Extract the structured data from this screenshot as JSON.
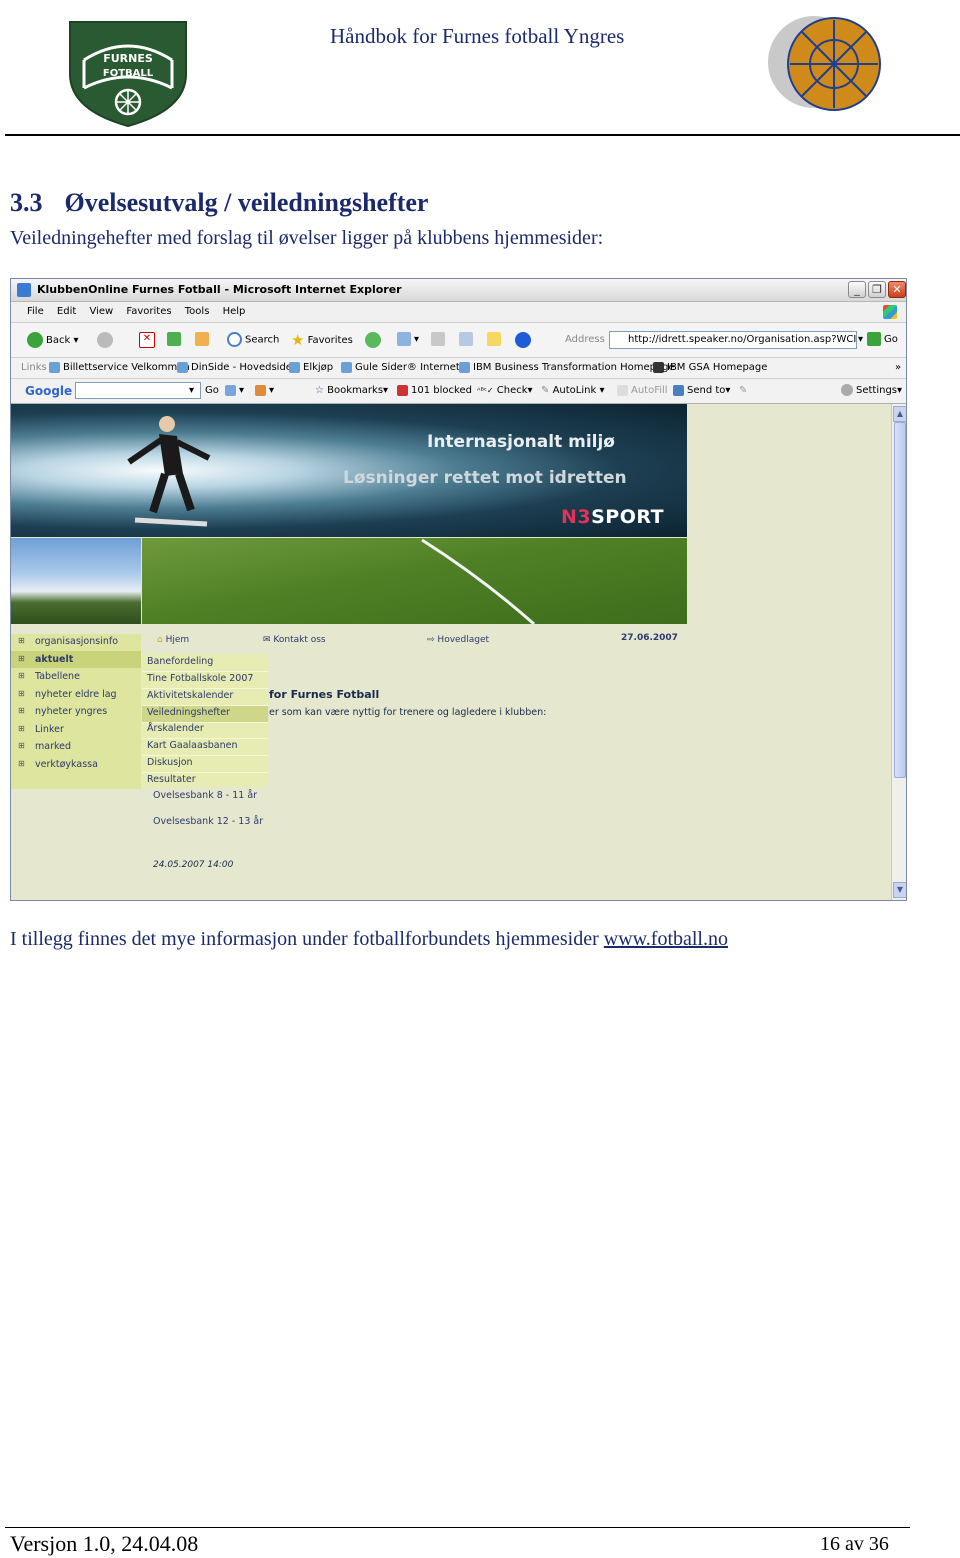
{
  "header": {
    "title": "Håndbok for Furnes fotball Yngres",
    "logo_left_text_top": "FURNES",
    "logo_left_text_bottom": "FOTBALL"
  },
  "section": {
    "number": "3.3",
    "heading": "Øvelsesutvalg / veiledningshefter",
    "intro": "Veiledningehefter med forslag til øvelser ligger på klubbens hjemmesider:",
    "outro_prefix": "I tillegg finnes det mye informasjon under fotballforbundets hjemmesider ",
    "outro_link": "www.fotball.no"
  },
  "browser": {
    "title": "KlubbenOnline Furnes Fotball - Microsoft Internet Explorer",
    "menu": [
      "File",
      "Edit",
      "View",
      "Favorites",
      "Tools",
      "Help"
    ],
    "toolbar": {
      "back": "Back",
      "search": "Search",
      "favorites": "Favorites",
      "address_label": "Address",
      "address": "http://idrett.speaker.no/Organisation.asp?WCI=wil",
      "go": "Go"
    },
    "links": {
      "label": "Links",
      "items": [
        "Billettservice Velkommen",
        "DinSide - Hovedside",
        "Elkjøp",
        "Gule Sider® Internett",
        "IBM Business Transformation Homepage",
        "IBM GSA Homepage"
      ]
    },
    "google_bar": {
      "brand": "Google",
      "go": "Go",
      "bookmarks": "Bookmarks",
      "blocked": "101 blocked",
      "check": "Check",
      "autolink": "AutoLink",
      "autofill": "AutoFill",
      "send_to": "Send to",
      "settings": "Settings"
    }
  },
  "site": {
    "banner_title": "Internasjonalt miljø",
    "banner_subtitle": "Løsninger rettet mot idretten",
    "brand_n3": "N3",
    "brand_sport": "SPORT",
    "nav": {
      "home": "Hjem",
      "contact": "Kontakt oss",
      "main_team": "Hovedlaget",
      "date": "27.06.2007"
    },
    "side_menu": [
      "organisasjonsinfo",
      "aktuelt",
      "Tabellene",
      "nyheter eldre lag",
      "nyheter yngres",
      "Linker",
      "marked",
      "verktøykassa"
    ],
    "sub_menu": [
      "Banefordeling",
      "Tine Fotballskole 2007",
      "Aktivitetskalender",
      "Veiledningshefter",
      "Årskalender",
      "Kart Gaalaasbanen",
      "Diskusjon",
      "Resultater"
    ],
    "content_title": "for Furnes Fotball",
    "content_text": "er som kan være nyttig for trenere og lagledere i klubben:",
    "doc_links": [
      "Ovelsesbank 8 - 11 år",
      "Ovelsesbank 12 - 13 år"
    ],
    "content_date": "24.05.2007 14:00"
  },
  "footer": {
    "version": "Versjon 1.0, 24.04.08",
    "page": "16 av 36"
  },
  "colors": {
    "heading": "#1b2a6b",
    "club_green": "#2a5a32",
    "menu_green": "#dde59e"
  }
}
